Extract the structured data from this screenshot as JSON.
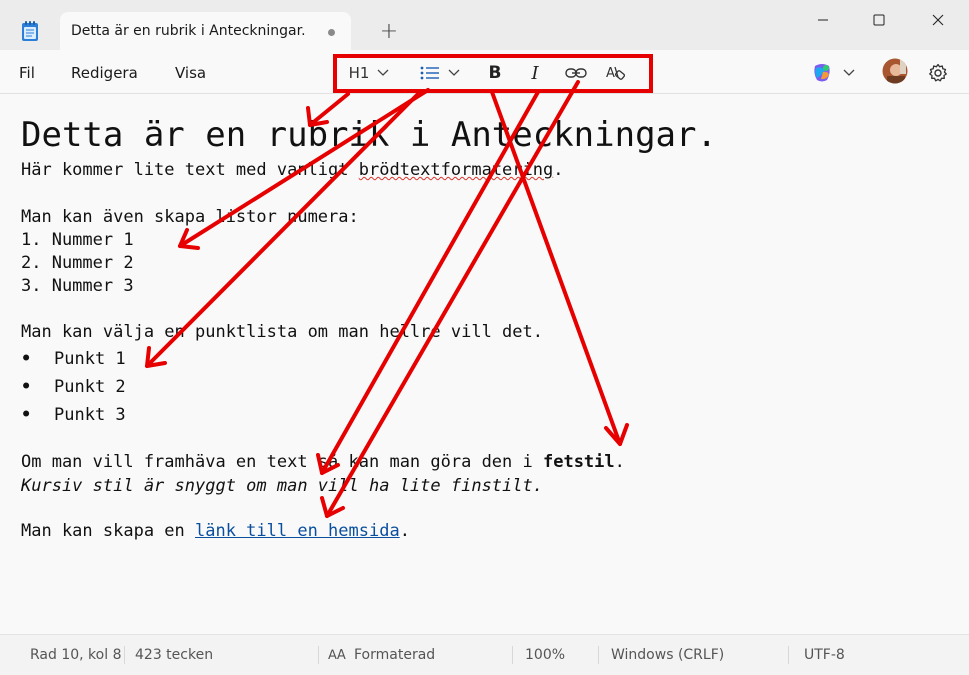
{
  "titlebar": {
    "tab_title": "Detta är en rubrik i Anteckningar.",
    "new_tab": "+"
  },
  "menu": {
    "file": "Fil",
    "edit": "Redigera",
    "view": "Visa"
  },
  "toolbar": {
    "heading": "H1",
    "bold": "B",
    "italic": "I"
  },
  "document": {
    "heading": "Detta är en rubrik i Anteckningar.",
    "line1_before": "Här kommer lite text med vanligt ",
    "line1_squiggle": "brödtextformatering",
    "line1_after": ".",
    "lists_intro": "Man kan även skapa listor numera:",
    "numbered": [
      "1. Nummer 1",
      "2. Nummer 2",
      "3. Nummer 3"
    ],
    "bullet_intro": "Man kan välja en punktlista om man hellre vill det.",
    "bullet_char": "•",
    "bullets": [
      "Punkt 1",
      "Punkt 2",
      "Punkt 3"
    ],
    "bold_before": "Om man vill framhäva en text så kan man göra den i ",
    "bold_word": "fetstil",
    "bold_after": ".",
    "italic_line": "Kursiv stil är snyggt om man vill ha lite finstilt.",
    "link_before": "Man kan skapa en ",
    "link_text": "länk till en hemsida",
    "link_after": "."
  },
  "status": {
    "position": "Rad 10, kol 8",
    "chars": "423 tecken",
    "format": "Formaterad",
    "zoom": "100%",
    "line_ending": "Windows (CRLF)",
    "encoding": "UTF-8"
  },
  "colors": {
    "annotation": "#e60000",
    "link": "#0a4f9e"
  }
}
